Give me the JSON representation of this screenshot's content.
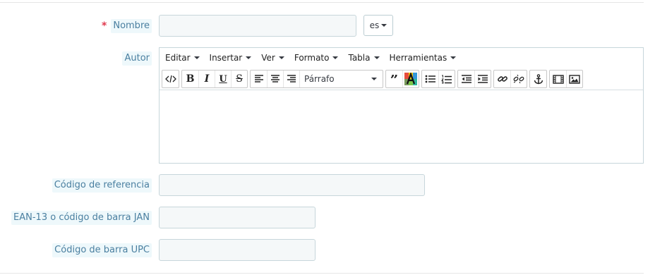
{
  "fields": {
    "nombre": {
      "label": "Nombre",
      "required_mark": "*",
      "value": ""
    },
    "language_switch": {
      "label": "es"
    },
    "autor": {
      "label": "Autor"
    },
    "codigo_referencia": {
      "label": "Código de referencia",
      "value": ""
    },
    "ean13": {
      "label": "EAN-13 o código de barra JAN",
      "value": ""
    },
    "upc": {
      "label": "Código de barra UPC",
      "value": ""
    }
  },
  "editor": {
    "menus": [
      "Editar",
      "Insertar",
      "Ver",
      "Formato",
      "Tabla",
      "Herramientas"
    ],
    "format_select": "Párrafo",
    "toolbar_icons": [
      "source-code-icon",
      "bold-icon",
      "italic-icon",
      "underline-icon",
      "strikethrough-icon",
      "align-left-icon",
      "align-center-icon",
      "align-right-icon",
      "blockquote-icon",
      "text-color-icon",
      "bullet-list-icon",
      "numbered-list-icon",
      "outdent-icon",
      "indent-icon",
      "link-icon",
      "unlink-icon",
      "anchor-icon",
      "media-icon",
      "image-icon"
    ],
    "content": ""
  },
  "colors": {
    "label_text": "#4a7fa0",
    "label_bg": "#eef8fb",
    "required": "#e0394e",
    "input_bg": "#f5f8f9",
    "input_border": "#c7d6db"
  }
}
